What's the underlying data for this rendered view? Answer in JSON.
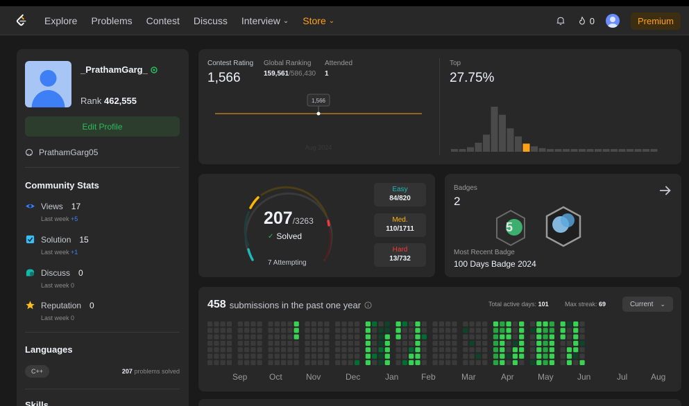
{
  "nav": {
    "links": [
      "Explore",
      "Problems",
      "Contest",
      "Discuss",
      "Interview",
      "Store"
    ],
    "streak": "0",
    "premium": "Premium"
  },
  "profile": {
    "username": "_PrathamGarg_",
    "rank_label": "Rank",
    "rank_value": "462,555",
    "edit_button": "Edit Profile",
    "github": "PrathamGarg05"
  },
  "community": {
    "title": "Community Stats",
    "items": [
      {
        "label": "Views",
        "value": "17",
        "sub": "Last week",
        "delta": "+5",
        "icon": "eye-icon",
        "color": "#3b82f6"
      },
      {
        "label": "Solution",
        "value": "15",
        "sub": "Last week",
        "delta": "+1",
        "icon": "check-square-icon",
        "color": "#38bdf8"
      },
      {
        "label": "Discuss",
        "value": "0",
        "sub": "Last week",
        "delta": "0",
        "icon": "chat-icon",
        "color": "#14b8a6"
      },
      {
        "label": "Reputation",
        "value": "0",
        "sub": "Last week",
        "delta": "0",
        "icon": "star-icon",
        "color": "#fbbf24"
      }
    ]
  },
  "languages": {
    "title": "Languages",
    "tag": "C++",
    "count": "207",
    "count_suffix": "problems solved"
  },
  "skills": {
    "title": "Skills"
  },
  "contest": {
    "rating_label": "Contest Rating",
    "rating": "1,566",
    "global_label": "Global Ranking",
    "global_rank": "159,561",
    "global_total": "/586,430",
    "attended_label": "Attended",
    "attended": "1",
    "tooltip": "1,566",
    "date": "Aug 2024",
    "top_label": "Top",
    "top_value": "27.75%",
    "histogram": [
      0.06,
      0.06,
      0.1,
      0.2,
      0.38,
      1.0,
      0.82,
      0.52,
      0.34,
      0.18,
      0.12,
      0.08,
      0.06,
      0.06,
      0.06,
      0.06,
      0.06,
      0.06,
      0.06,
      0.06,
      0.06,
      0.06,
      0.06,
      0.06,
      0.06,
      0.06
    ],
    "highlight_index": 9
  },
  "solved": {
    "count": "207",
    "total": "/3263",
    "label": "Solved",
    "attempting": "7 Attempting",
    "easy_label": "Easy",
    "easy": "84/820",
    "med_label": "Med.",
    "med": "110/1711",
    "hard_label": "Hard",
    "hard": "13/732",
    "colors": {
      "easy": "#1cbaba",
      "med": "#ffb700",
      "hard": "#f63737"
    }
  },
  "badges": {
    "label": "Badges",
    "count": "2",
    "recent_label": "Most Recent Badge",
    "recent": "100 Days Badge 2024"
  },
  "heatmap": {
    "count": "458",
    "text": "submissions in the past one year",
    "active_label": "Total active days:",
    "active": "101",
    "streak_label": "Max streak:",
    "streak": "69",
    "filter": "Current",
    "months": [
      "Sep",
      "Oct",
      "Nov",
      "Dec",
      "Jan",
      "Feb",
      "Mar",
      "Apr",
      "May",
      "Jun",
      "Jul",
      "Aug"
    ]
  }
}
